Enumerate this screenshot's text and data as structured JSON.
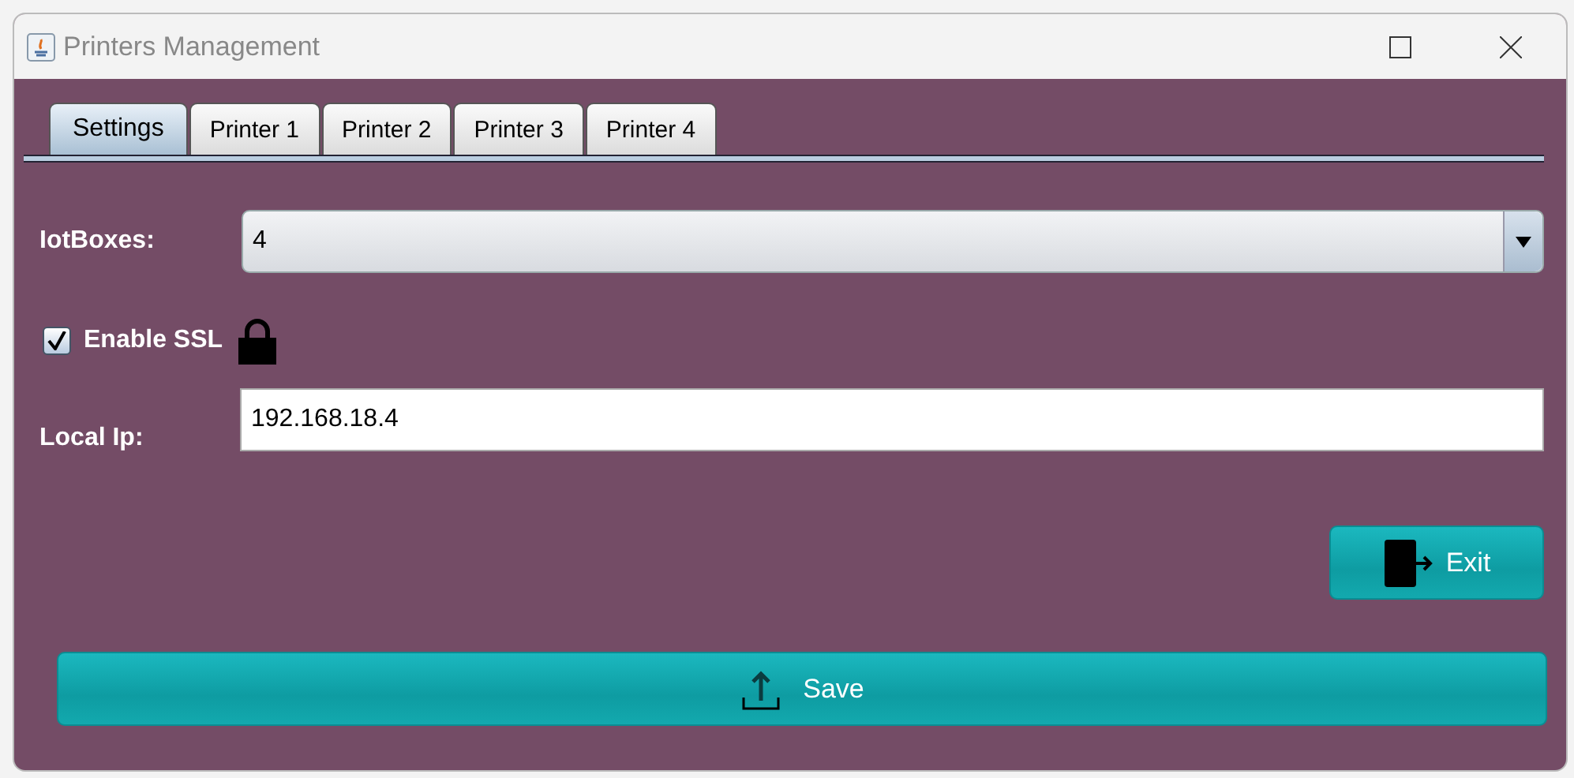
{
  "window": {
    "title": "Printers Management"
  },
  "tabs": [
    {
      "label": "Settings",
      "selected": true
    },
    {
      "label": "Printer 1",
      "selected": false
    },
    {
      "label": "Printer 2",
      "selected": false
    },
    {
      "label": "Printer 3",
      "selected": false
    },
    {
      "label": "Printer 4",
      "selected": false
    }
  ],
  "iotboxes": {
    "label": "IotBoxes:",
    "value": "4"
  },
  "ssl": {
    "label": "Enable SSL",
    "checked": true
  },
  "local_ip": {
    "label": "Local Ip:",
    "value": "192.168.18.4"
  },
  "buttons": {
    "exit": "Exit",
    "save": "Save"
  }
}
